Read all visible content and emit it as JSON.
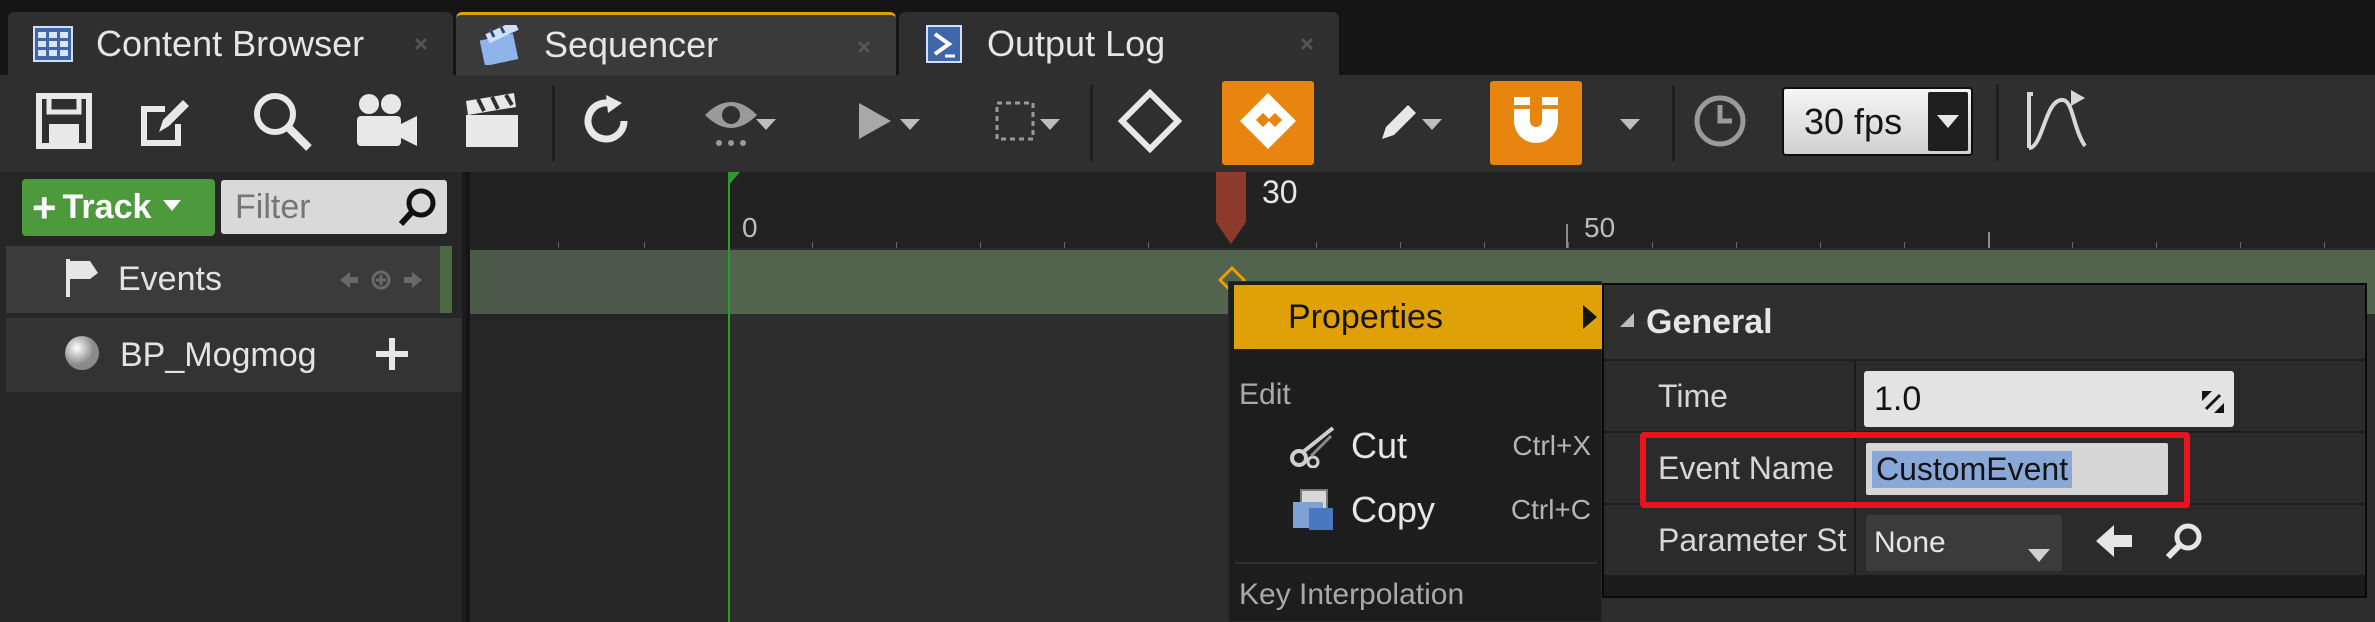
{
  "tabs": [
    {
      "label": "Content Browser",
      "icon": "content-browser-icon",
      "active": false
    },
    {
      "label": "Sequencer",
      "icon": "sequencer-icon",
      "active": true
    },
    {
      "label": "Output Log",
      "icon": "output-log-icon",
      "active": false
    }
  ],
  "toolbar": {
    "fps": "30 fps",
    "icons": [
      "save-icon",
      "edit-icon",
      "search-icon",
      "camera-icon",
      "clapper-icon",
      "refresh-icon",
      "eye-icon",
      "play-icon",
      "selection-icon",
      "key-icon",
      "keyframe-icon",
      "pencil-icon",
      "magnet-icon",
      "clock-icon",
      "curve-editor-icon"
    ]
  },
  "left_panel": {
    "track_button": "Track",
    "filter_placeholder": "Filter",
    "tracks": [
      {
        "label": "Events",
        "icon": "flag-icon"
      },
      {
        "label": "BP_Mogmog",
        "icon": "sphere-icon"
      }
    ]
  },
  "timeline": {
    "ruler_labels": [
      "0",
      "50"
    ],
    "playhead_frame": "30"
  },
  "context_menu": {
    "properties": "Properties",
    "edit_section": "Edit",
    "items": [
      {
        "label": "Cut",
        "shortcut": "Ctrl+X",
        "icon": "scissors-icon"
      },
      {
        "label": "Copy",
        "shortcut": "Ctrl+C",
        "icon": "copy-icon"
      }
    ],
    "key_interp_section": "Key Interpolation"
  },
  "details": {
    "section": "General",
    "time_label": "Time",
    "time_value": "1.0",
    "event_name_label": "Event Name",
    "event_name_value": "CustomEvent",
    "param_label": "Parameter St",
    "param_value": "None"
  },
  "colors": {
    "accent_orange": "#e8850f",
    "menu_highlight": "#e0a106",
    "track_green": "#4c9a3c",
    "highlight_red": "#e8131c"
  }
}
